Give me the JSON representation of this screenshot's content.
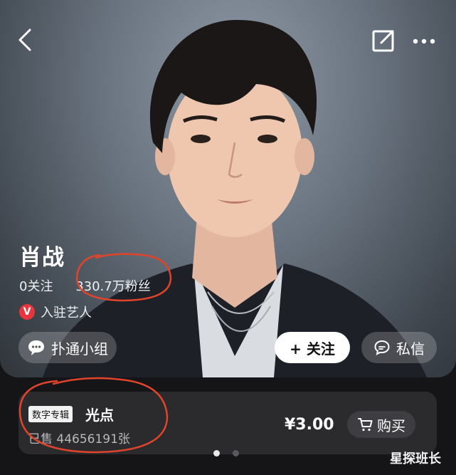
{
  "profile": {
    "name": "肖战",
    "following": "0关注",
    "fans": "330.7万粉丝",
    "verified_badge": "V",
    "verified_label": "入驻艺人"
  },
  "actions": {
    "group": "扑通小组",
    "follow": "+ 关注",
    "message": "私信"
  },
  "album": {
    "tag": "数字专辑",
    "title": "光点",
    "sold": "已售 44656191张",
    "price": "¥3.00",
    "buy": "购买"
  },
  "carousel": {
    "count": 2,
    "active_index": 0
  },
  "watermark": "星探班长",
  "colors": {
    "annotation": "#e0442a",
    "verified_badge": "#e8363c"
  },
  "icons": [
    "back-icon",
    "share-icon",
    "more-icon",
    "chat-bubble-icon",
    "message-icon",
    "cart-icon"
  ]
}
